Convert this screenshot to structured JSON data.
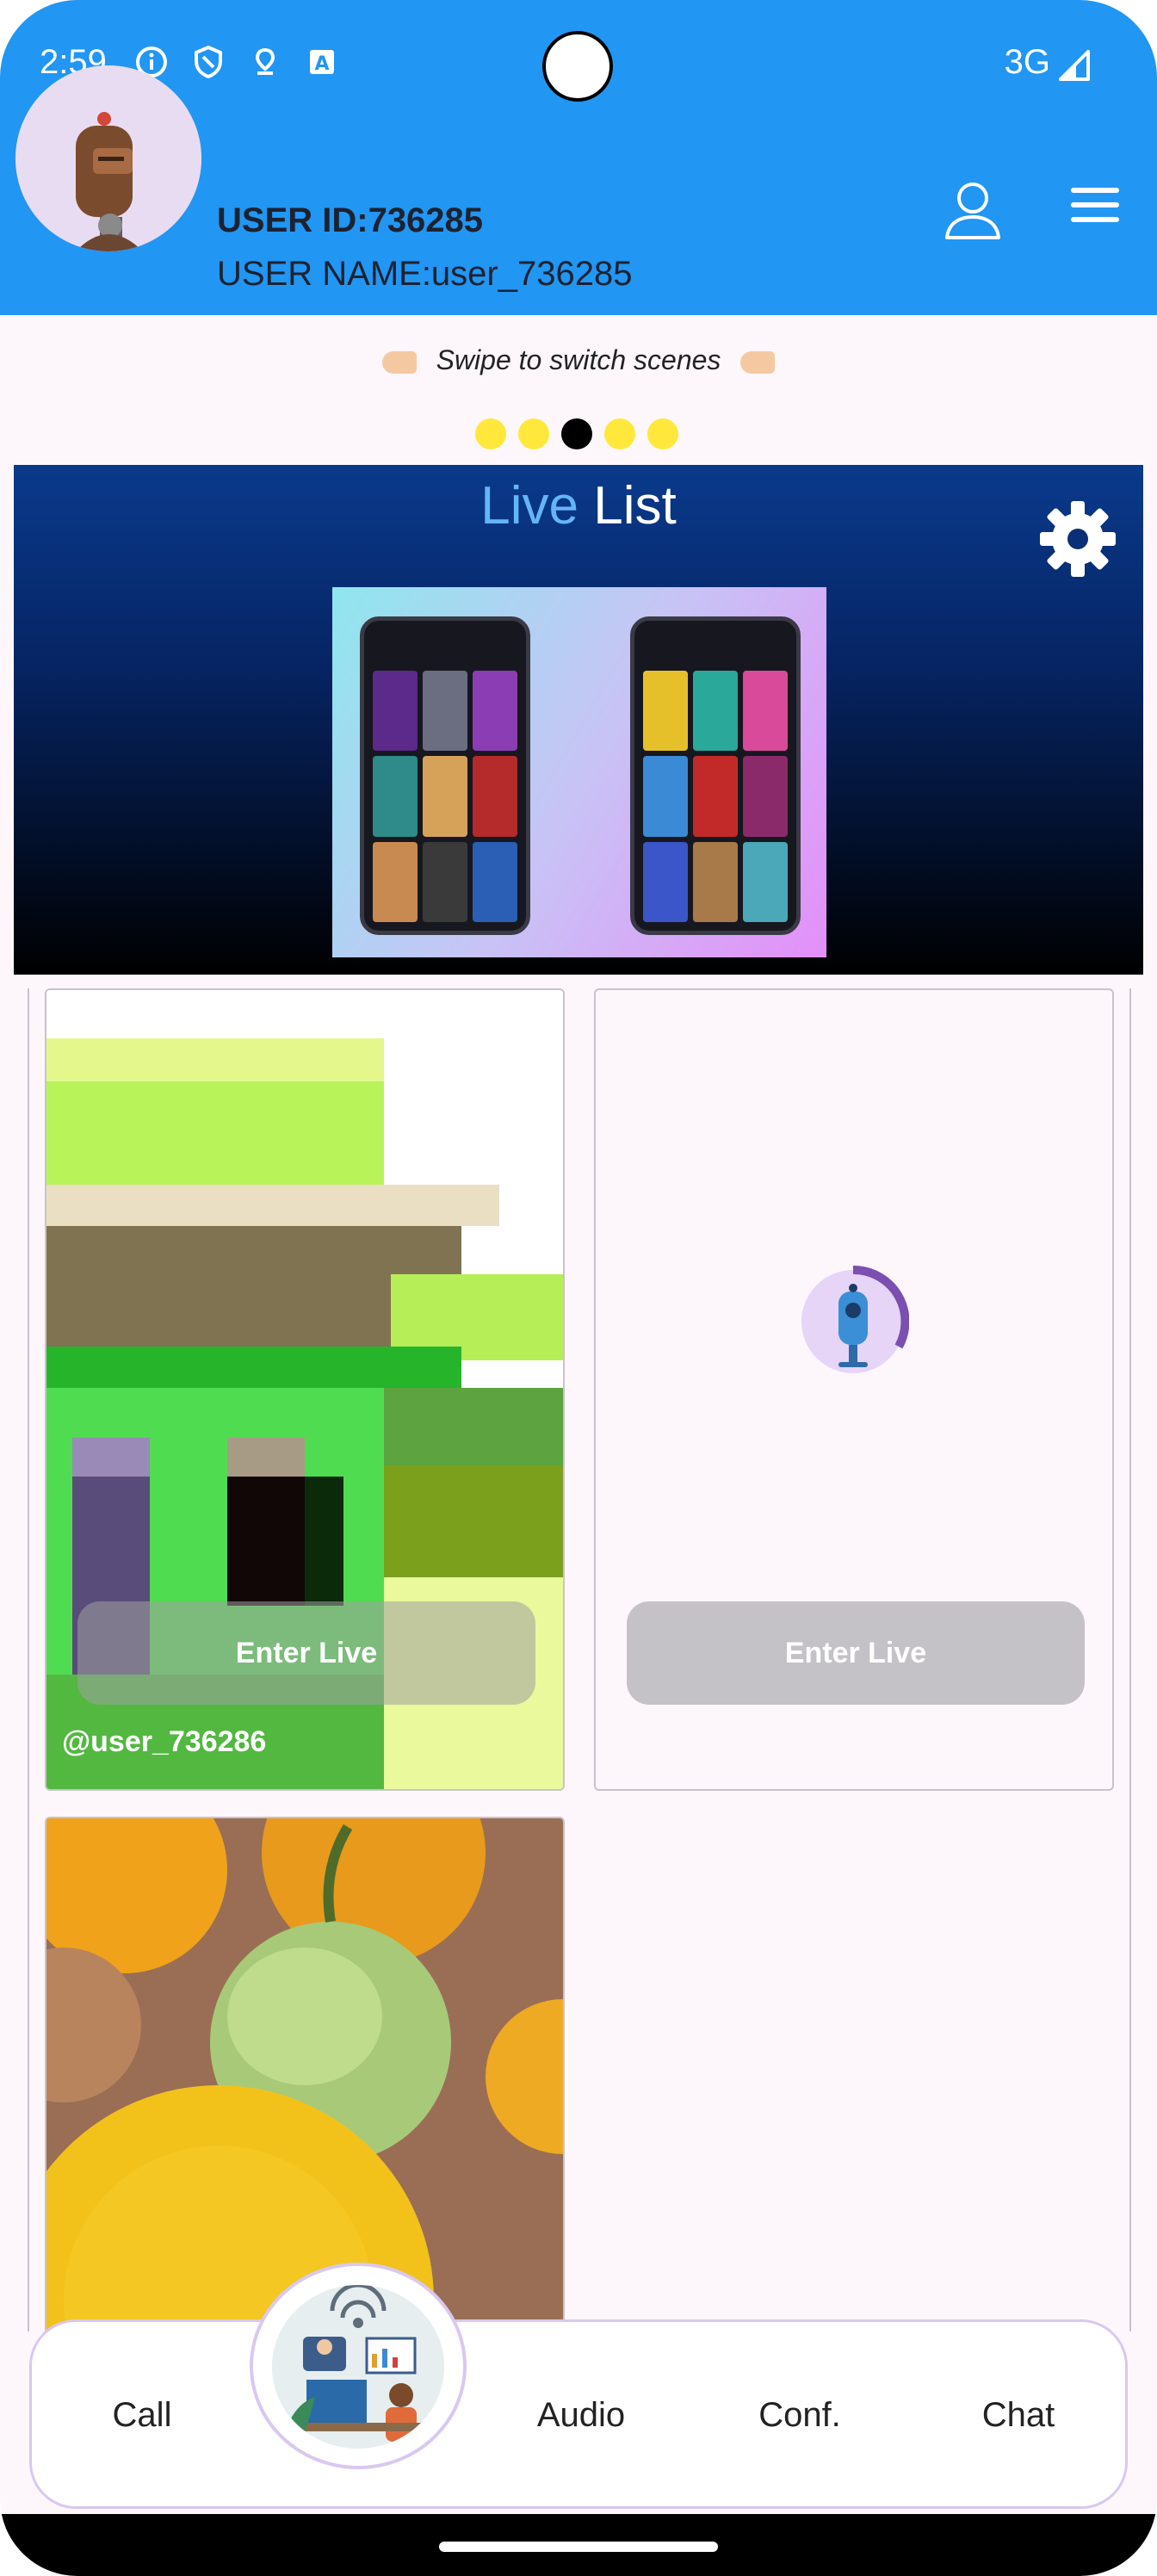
{
  "status_bar": {
    "time": "2:59",
    "network": "3G"
  },
  "header": {
    "user_id": "USER ID:736285",
    "user_name": "USER NAME:user_736285"
  },
  "swipe_hint": {
    "text": "Swipe to switch scenes",
    "page_count": 5,
    "active_page": 3
  },
  "banner": {
    "title_part1": "Live",
    "title_part2": "List"
  },
  "cards": [
    {
      "button_label": "Enter Live",
      "username": "@user_736286"
    },
    {
      "button_label": "Enter Live"
    }
  ],
  "bottom_nav": {
    "items": [
      "Call",
      "Audio",
      "Conf.",
      "Chat"
    ]
  },
  "colors": {
    "header_bg": "#2196f3",
    "banner_accent": "#64b5f6",
    "dot_inactive": "#ffe83b",
    "dot_active": "#000000"
  }
}
